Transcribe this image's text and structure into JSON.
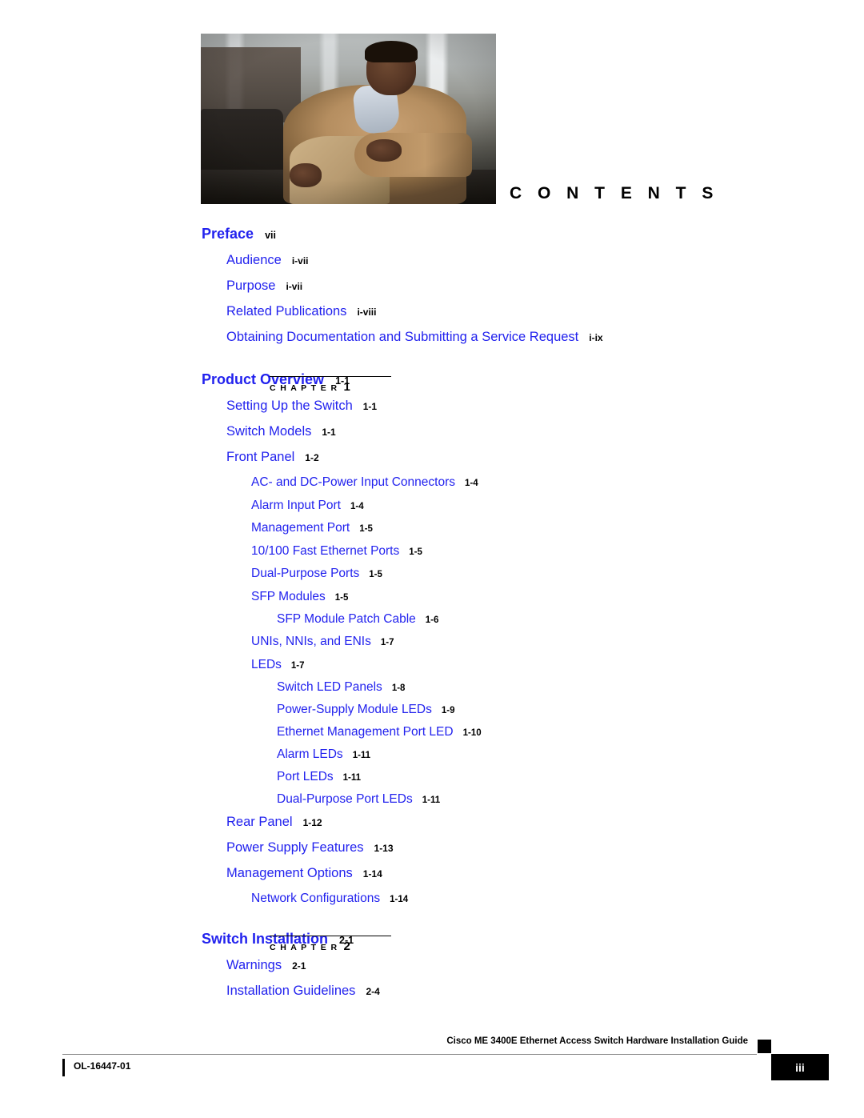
{
  "page": {
    "heading": "C O N T E N T S"
  },
  "cover_photo": {
    "alt": "seated-man-in-tan-jacket-photo"
  },
  "toc": [
    {
      "level": 1,
      "title": "Preface",
      "page": "vii",
      "chapter": null
    },
    {
      "level": 2,
      "title": "Audience",
      "page": "i-vii"
    },
    {
      "level": 2,
      "title": "Purpose",
      "page": "i-vii"
    },
    {
      "level": 2,
      "title": "Related Publications",
      "page": "i-viii"
    },
    {
      "level": 2,
      "title": "Obtaining Documentation and Submitting a Service Request",
      "page": "i-ix"
    },
    {
      "level": 1,
      "title": "Product Overview",
      "page": "1-1",
      "chapter": {
        "word": "C H A P T E R",
        "number": "1"
      }
    },
    {
      "level": 2,
      "title": "Setting Up the Switch",
      "page": "1-1"
    },
    {
      "level": 2,
      "title": "Switch Models",
      "page": "1-1"
    },
    {
      "level": 2,
      "title": "Front Panel",
      "page": "1-2"
    },
    {
      "level": 3,
      "title": "AC- and DC-Power Input Connectors",
      "page": "1-4"
    },
    {
      "level": 3,
      "title": "Alarm Input Port",
      "page": "1-4"
    },
    {
      "level": 3,
      "title": "Management Port",
      "page": "1-5"
    },
    {
      "level": 3,
      "title": "10/100 Fast Ethernet Ports",
      "page": "1-5"
    },
    {
      "level": 3,
      "title": "Dual-Purpose Ports",
      "page": "1-5"
    },
    {
      "level": 3,
      "title": "SFP Modules",
      "page": "1-5"
    },
    {
      "level": 4,
      "title": "SFP Module Patch Cable",
      "page": "1-6"
    },
    {
      "level": 3,
      "title": "UNIs, NNIs, and ENIs",
      "page": "1-7"
    },
    {
      "level": 3,
      "title": "LEDs",
      "page": "1-7"
    },
    {
      "level": 4,
      "title": "Switch LED Panels",
      "page": "1-8"
    },
    {
      "level": 4,
      "title": "Power-Supply Module LEDs",
      "page": "1-9"
    },
    {
      "level": 4,
      "title": "Ethernet Management Port LED",
      "page": "1-10"
    },
    {
      "level": 4,
      "title": "Alarm LEDs",
      "page": "1-11"
    },
    {
      "level": 4,
      "title": "Port LEDs",
      "page": "1-11"
    },
    {
      "level": 4,
      "title": "Dual-Purpose Port LEDs",
      "page": "1-11"
    },
    {
      "level": 2,
      "title": "Rear Panel",
      "page": "1-12"
    },
    {
      "level": 2,
      "title": "Power Supply Features",
      "page": "1-13"
    },
    {
      "level": 2,
      "title": "Management Options",
      "page": "1-14"
    },
    {
      "level": 3,
      "title": "Network Configurations",
      "page": "1-14"
    },
    {
      "level": 1,
      "title": "Switch Installation",
      "page": "2-1",
      "chapter": {
        "word": "C H A P T E R",
        "number": "2"
      }
    },
    {
      "level": 2,
      "title": "Warnings",
      "page": "2-1"
    },
    {
      "level": 2,
      "title": "Installation Guidelines",
      "page": "2-4"
    }
  ],
  "footer": {
    "guide_title": "Cisco ME 3400E Ethernet Access Switch Hardware Installation Guide",
    "doc_id": "OL-16447-01",
    "page_number": "iii"
  },
  "colors": {
    "link_blue": "#2222ee",
    "text_black": "#000000",
    "rule_gray": "#8a8a8a"
  }
}
